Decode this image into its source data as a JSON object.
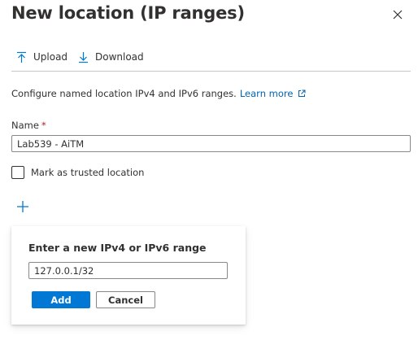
{
  "panel": {
    "title": "New location (IP ranges)",
    "close_icon": "close-icon"
  },
  "toolbar": {
    "upload_label": "Upload",
    "upload_icon": "upload-icon",
    "download_label": "Download",
    "download_icon": "download-icon"
  },
  "description": {
    "text": "Configure named location IPv4 and IPv6 ranges.",
    "link_text": "Learn more",
    "link_icon": "external-link-icon"
  },
  "name_field": {
    "label": "Name",
    "required_marker": "*",
    "value": "Lab539 - AiTM"
  },
  "trusted_checkbox": {
    "label": "Mark as trusted location",
    "checked": false
  },
  "add_range": {
    "icon": "plus-icon"
  },
  "callout": {
    "title": "Enter a new IPv4 or IPv6 range",
    "range_value": "127.0.0.1/32",
    "add_label": "Add",
    "cancel_label": "Cancel"
  },
  "colors": {
    "accent": "#0078d4",
    "link": "#0064b4",
    "required": "#a4262c",
    "text": "#323130"
  }
}
